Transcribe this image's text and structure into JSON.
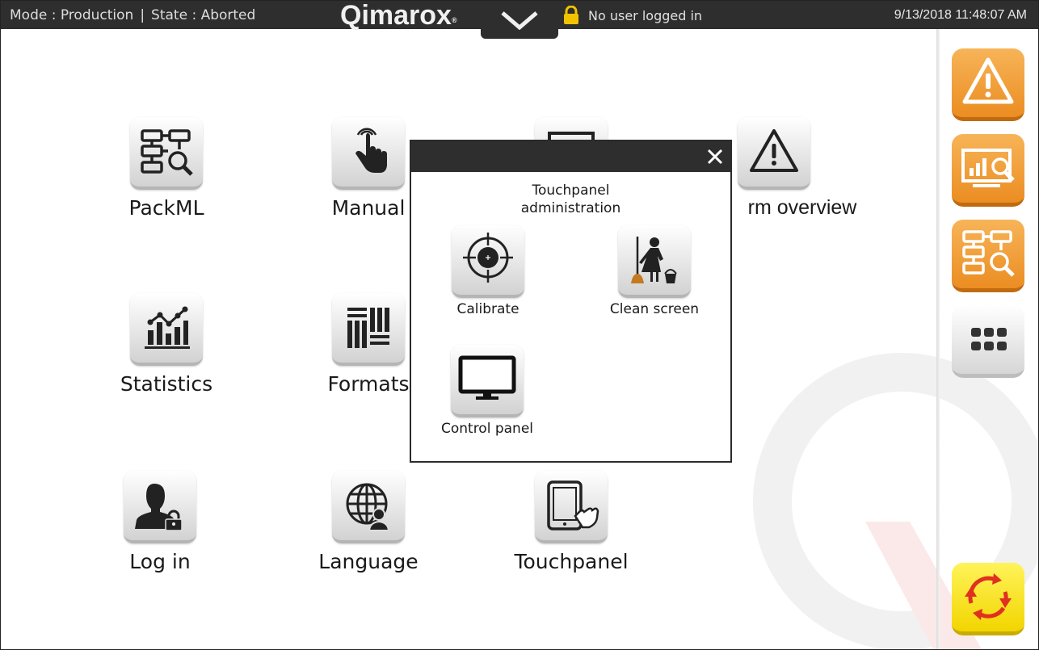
{
  "topbar": {
    "mode": "Mode : Production",
    "state": "State : Aborted",
    "brand": "Qimarox",
    "user": "No user logged in",
    "datetime": "9/13/2018 11:48:07 AM"
  },
  "tiles": {
    "packml": "PackML",
    "manual": "Manual",
    "alarm_overview": "rm overview",
    "statistics": "Statistics",
    "formats": "Formats",
    "login": "Log in",
    "language": "Language",
    "touchpanel": "Touchpanel"
  },
  "dialog": {
    "title_line1": "Touchpanel",
    "title_line2": "administration",
    "calibrate": "Calibrate",
    "clean_screen": "Clean screen",
    "control_panel": "Control panel"
  },
  "rail": {
    "items": [
      "alarm-icon",
      "monitor-analytics-icon",
      "packml-icon",
      "grid-menu-icon",
      "reset-cycle-icon"
    ]
  },
  "colors": {
    "topbar": "#2e2e2e",
    "rail_orange": "#eb8d22",
    "rail_yellow": "#f2d500",
    "refresh_red": "#e03020"
  }
}
